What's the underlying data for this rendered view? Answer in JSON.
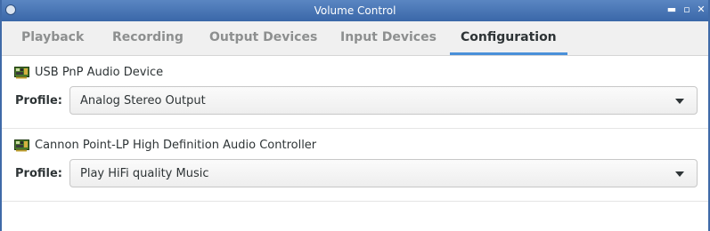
{
  "window": {
    "title": "Volume Control",
    "menu_icon": "window-menu-icon",
    "minimize_glyph": "▬",
    "maximize_glyph": "▫",
    "close_glyph": "✕"
  },
  "tabs": [
    {
      "label": "Playback",
      "active": false
    },
    {
      "label": "Recording",
      "active": false
    },
    {
      "label": "Output Devices",
      "active": false
    },
    {
      "label": "Input Devices",
      "active": false
    },
    {
      "label": "Configuration",
      "active": true
    }
  ],
  "devices": [
    {
      "name": "USB PnP Audio Device",
      "icon": "audio-card-icon",
      "profile_label": "Profile:",
      "profile_value": "Analog Stereo Output"
    },
    {
      "name": "Cannon Point-LP High Definition Audio Controller",
      "icon": "audio-card-icon",
      "profile_label": "Profile:",
      "profile_value": "Play HiFi quality Music"
    }
  ],
  "colors": {
    "accent": "#4a90d9",
    "titlebar": "#3a67a8",
    "active_tab_text": "#2e3436",
    "inactive_tab_text": "#8d8f8f"
  }
}
